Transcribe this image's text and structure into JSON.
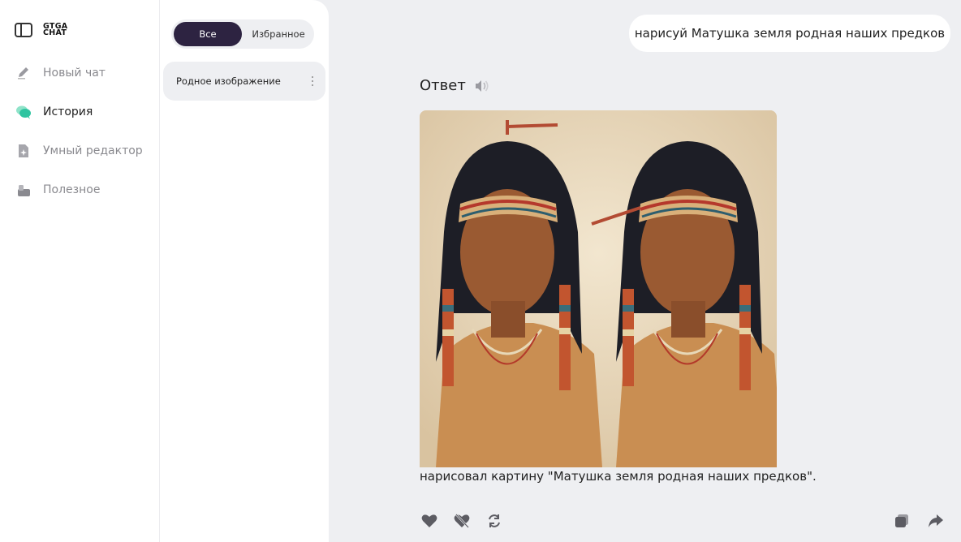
{
  "logo": {
    "line1": "GTGA",
    "line2": "CHAT"
  },
  "nav": {
    "items": [
      {
        "label": "Новый чат",
        "icon": "pencil-icon"
      },
      {
        "label": "История",
        "icon": "chat-bubbles-icon"
      },
      {
        "label": "Умный редактор",
        "icon": "smart-doc-icon"
      },
      {
        "label": "Полезное",
        "icon": "toolbox-icon"
      }
    ],
    "active": "История"
  },
  "history": {
    "filters": {
      "all": "Все",
      "favorites": "Избранное",
      "selected": "Все"
    },
    "items": [
      {
        "title": "Родное изображение"
      }
    ]
  },
  "chat": {
    "user_message": "нарисуй Матушка земля родная наших предков",
    "answer_title": "Ответ",
    "answer_caption": "нарисовал картину \"Матушка земля родная наших предков\"."
  },
  "colors": {
    "accent": "#2d2341",
    "active_icon": "#2ec4a0",
    "background": "#eeeff2"
  }
}
